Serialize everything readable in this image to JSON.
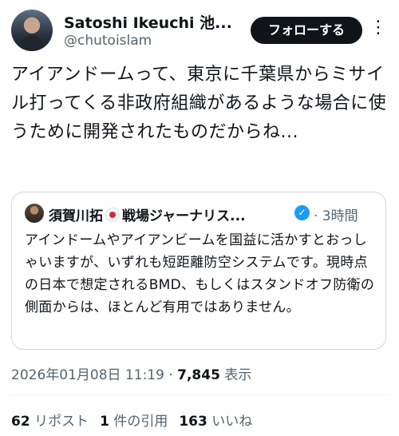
{
  "author": {
    "name": "Satoshi Ikeuchi 池...",
    "handle": "@chutoislam",
    "follow_label": "フォローする",
    "more_icon": "more-icon"
  },
  "tweet": {
    "text": "アイアンドームって、東京に千葉県からミサイル打ってくる非政府組織があるような場合に使うために開発されたものだからね..."
  },
  "quote": {
    "name_part1": "須賀川拓",
    "name_part2": "戦場ジャーナリス...",
    "verified_icon": "verified-badge-icon",
    "time": "· 3時間",
    "text": "アインドームやアイアンビームを国益に活かすとおっしゃいますが、いずれも短距離防空システムです。現時点の日本で想定されるBMD、もしくはスタンドオフ防衛の側面からは、ほとんど有用ではありません。"
  },
  "meta": {
    "datetime": "2026年01月08日 11:19 · ",
    "views_count": "7,845",
    "views_label": " 表示"
  },
  "stats": {
    "reposts_count": "62",
    "reposts_label": " リポスト",
    "quotes_count": "1",
    "quotes_label": " 件の引用",
    "likes_count": "163",
    "likes_label": " いいね"
  }
}
